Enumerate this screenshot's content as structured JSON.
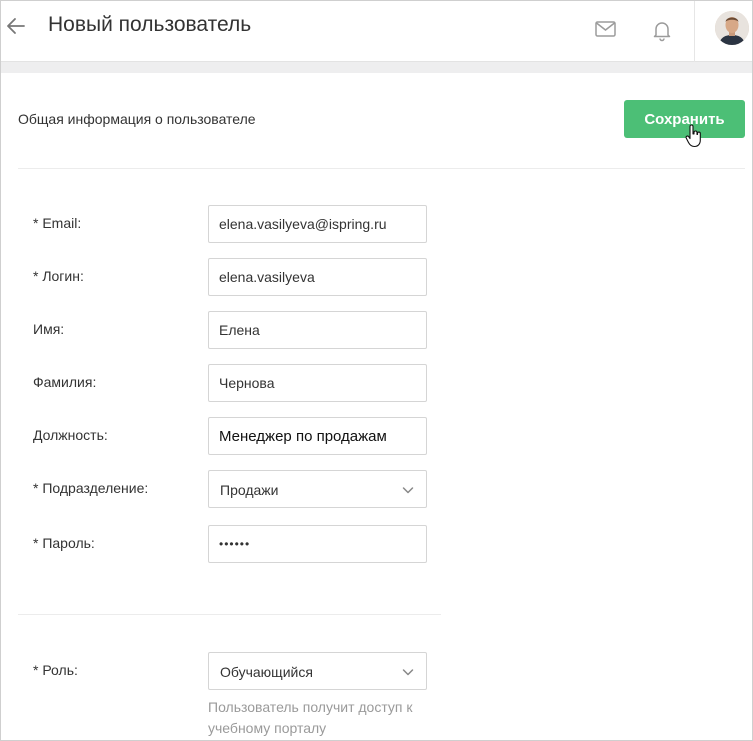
{
  "header": {
    "title": "Новый пользователь",
    "back_icon": "arrow-left-icon",
    "mail_icon": "mail-icon",
    "bell_icon": "bell-icon"
  },
  "section": {
    "title": "Общая информация о пользователе",
    "save_label": "Сохранить"
  },
  "fields": {
    "email": {
      "label": "* Email:",
      "value": "elena.vasilyeva@ispring.ru"
    },
    "login": {
      "label": "* Логин:",
      "value": "elena.vasilyeva"
    },
    "first_name": {
      "label": "Имя:",
      "value": "Елена"
    },
    "last_name": {
      "label": "Фамилия:",
      "value": "Чернова"
    },
    "position": {
      "label": "Должность:",
      "value": "Менеджер по продажам"
    },
    "department": {
      "label": "* Подразделение:",
      "value": "Продажи"
    },
    "password": {
      "label": "* Пароль:",
      "value": "••••••"
    },
    "role": {
      "label": "* Роль:",
      "value": "Обучающийся",
      "hint": "Пользователь получит доступ к учебному порталу"
    }
  },
  "colors": {
    "accent": "#4cbf76",
    "background_strip": "#eeeeef",
    "hint_text": "#9a9a9a"
  }
}
